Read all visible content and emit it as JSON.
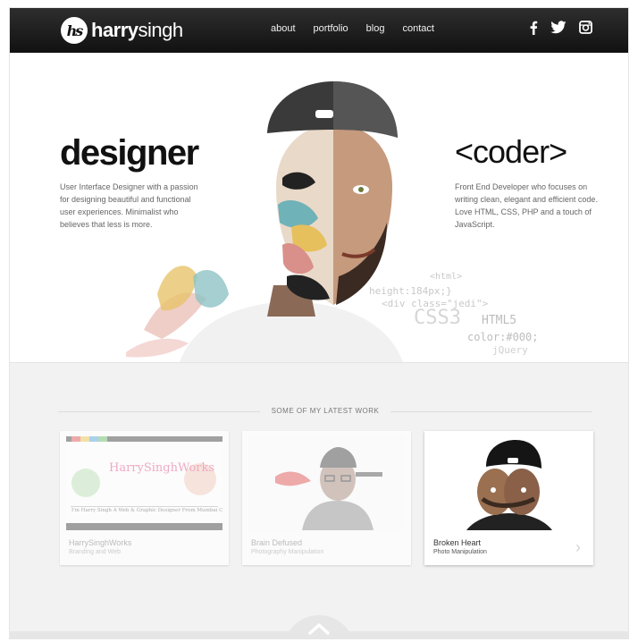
{
  "header": {
    "logo_mark": "hs",
    "logo_bold": "harry",
    "logo_light": "singh",
    "nav": [
      "about",
      "portfolio",
      "blog",
      "contact"
    ],
    "social_icons": [
      "facebook-icon",
      "twitter-icon",
      "instagram-icon"
    ]
  },
  "hero": {
    "left_title": "designer",
    "left_desc": "User Interface Designer with a passion for designing beautiful and functional user experiences. Minimalist who believes that less is more.",
    "right_title": "<coder>",
    "right_desc": "Front End Developer who focuses on writing clean, elegant and efficient code. Love HTML, CSS, PHP and a touch of JavaScript.",
    "code_snippets": [
      "<html>",
      "height:184px;}",
      "<div class=\"jedi\">",
      "CSS3",
      "HTML5",
      "color:#000;",
      "jQuery"
    ]
  },
  "work": {
    "title": "SOME OF MY LATEST WORK",
    "cards": [
      {
        "name": "HarrySinghWorks",
        "category": "Branding and Web",
        "thumb_title": "HarrySinghWorks",
        "thumb_tagline": "I'm Harry Singh A Web & Graphic Designer From Mumbai City."
      },
      {
        "name": "Brain Defused",
        "category": "Photography Manipulation"
      },
      {
        "name": "Broken Heart",
        "category": "Photo Manipulation"
      }
    ],
    "next_arrow": "›"
  },
  "colors": {
    "header_bg": "#1a1a1a",
    "section_bg": "#f2f2f2",
    "text_dark": "#111111"
  }
}
